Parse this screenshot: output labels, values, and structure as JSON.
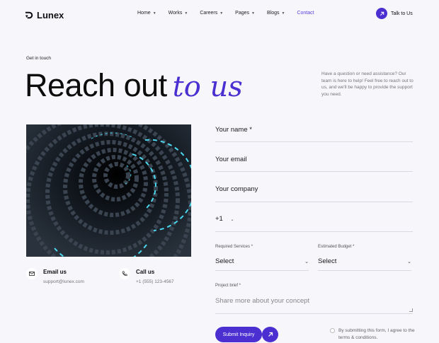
{
  "header": {
    "brand": "Lunex",
    "nav": [
      {
        "label": "Home",
        "dropdown": true
      },
      {
        "label": "Works",
        "dropdown": true
      },
      {
        "label": "Careers",
        "dropdown": true
      },
      {
        "label": "Pages",
        "dropdown": true
      },
      {
        "label": "Blogs",
        "dropdown": true
      },
      {
        "label": "Contact",
        "dropdown": false,
        "active": true
      }
    ],
    "cta": "Talk to Us"
  },
  "hero": {
    "eyebrow": "Get in touch",
    "title_main": "Reach out",
    "title_accent": "to us",
    "description": "Have a question or need assistance? Our team is here to help! Feel free to reach out to us, and we'll be happy to provide the support you need."
  },
  "contacts": {
    "email_title": "Email us",
    "email_value": "support@lunex.com",
    "call_title": "Call us",
    "call_value": "+1 (555) 123-4567"
  },
  "form": {
    "name": "Your name *",
    "email": "Your email",
    "company": "Your company",
    "phone_code": "+1",
    "services_label": "Required Services *",
    "services_value": "Select",
    "budget_label": "Estimated Budget *",
    "budget_value": "Select",
    "brief_label": "Project brief *",
    "brief_placeholder": "Share more about your concept",
    "submit": "Submit Inquiry",
    "terms": "By submitting this form, I agree to the terms & conditions."
  },
  "colors": {
    "accent": "#4b2fd0",
    "background": "#f6f6fb"
  }
}
